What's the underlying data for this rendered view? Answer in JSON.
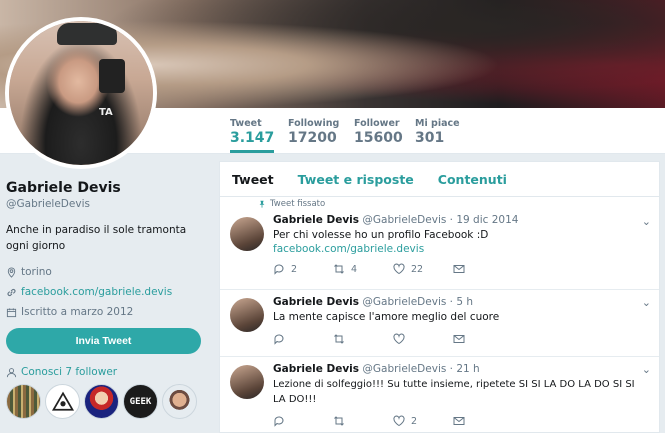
{
  "stats": [
    {
      "label": "Tweet",
      "value": "3.147",
      "active": true
    },
    {
      "label": "Following",
      "value": "17200",
      "active": false
    },
    {
      "label": "Follower",
      "value": "15600",
      "active": false
    },
    {
      "label": "Mi piace",
      "value": "301",
      "active": false
    }
  ],
  "avatar_vest_text": "TA",
  "profile": {
    "name": "Gabriele Devis",
    "handle": "@GabrieleDevis",
    "bio": "Anche in paradiso il sole tramonta ogni giorno",
    "location": "torino",
    "website": "facebook.com/gabriele.devis",
    "joined": "Iscritto a marzo 2012",
    "tweet_button": "Invia Tweet",
    "followers_you_know": "Conosci 7 follower",
    "follower_avatar_text": "GEEK"
  },
  "tabs": {
    "tweets": "Tweet",
    "replies": "Tweet e risposte",
    "media": "Contenuti"
  },
  "tweets": [
    {
      "pinned_label": "Tweet fissato",
      "name": "Gabriele Devis",
      "meta": "@GabrieleDevis · 19 dic 2014",
      "text": "Per chi volesse ho un profilo Facebook :D",
      "link": "facebook.com/gabriele.devis",
      "replies": "2",
      "retweets": "4",
      "likes": "22"
    },
    {
      "name": "Gabriele Devis",
      "meta": "@GabrieleDevis · 5 h",
      "text": "La mente capisce l'amore meglio del cuore",
      "replies": "",
      "retweets": "",
      "likes": ""
    },
    {
      "name": "Gabriele Devis",
      "meta": "@GabrieleDevis · 21 h",
      "text": "Lezione di solfeggio!!! Su tutte insieme, ripetete SI SI LA DO LA DO SI SI LA DO!!!",
      "replies": "",
      "retweets": "",
      "likes": "2"
    }
  ],
  "colors": {
    "accent": "#2a9d9d",
    "button": "#2ea8a8",
    "muted": "#657786",
    "background": "#e6ecf0"
  }
}
